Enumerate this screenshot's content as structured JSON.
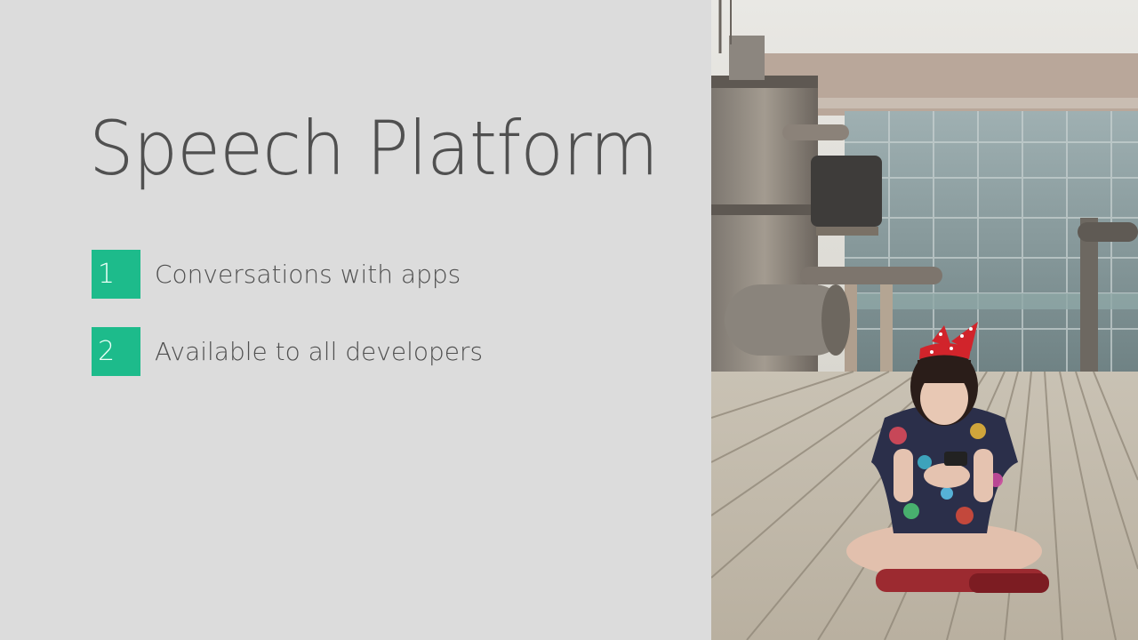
{
  "slide": {
    "title": "Speech Platform",
    "items": [
      {
        "number": "1",
        "label": "Conversations with apps"
      },
      {
        "number": "2",
        "label": "Available to all developers"
      }
    ]
  },
  "colors": {
    "background": "#dcdcdc",
    "accent": "#1dbb8b",
    "title_text": "#505050",
    "item_text": "#4f4f4f"
  },
  "photo": {
    "subject": "person-sitting-on-boardwalk-with-phone"
  }
}
